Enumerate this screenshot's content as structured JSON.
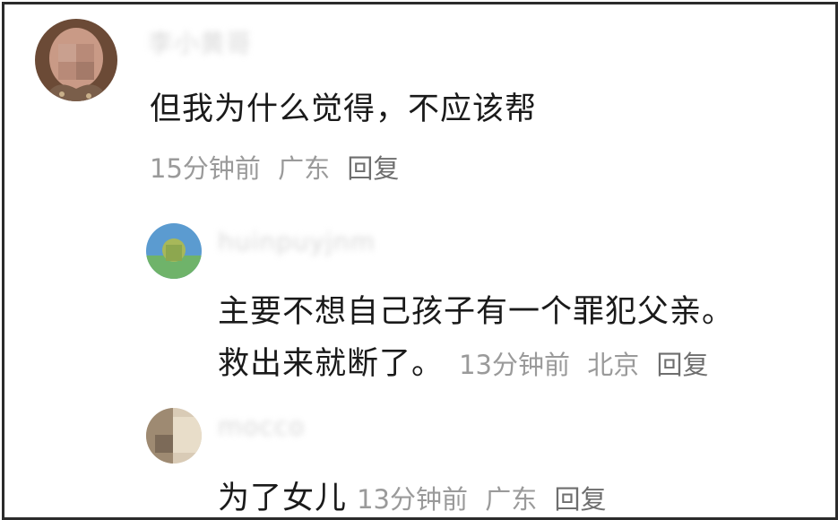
{
  "comments": [
    {
      "username": "李小黄哥",
      "text": "但我为什么觉得，不应该帮",
      "time": "15分钟前",
      "location": "广东",
      "reply_label": "回复"
    },
    {
      "username": "huinpuyjnm",
      "text_line1": "主要不想自己孩子有一个罪犯父亲。",
      "text_line2": "救出来就断了。",
      "time": "13分钟前",
      "location": "北京",
      "reply_label": "回复"
    },
    {
      "username": "mocco",
      "text": "为了女儿",
      "time": "13分钟前",
      "location": "广东",
      "reply_label": "回复"
    }
  ]
}
